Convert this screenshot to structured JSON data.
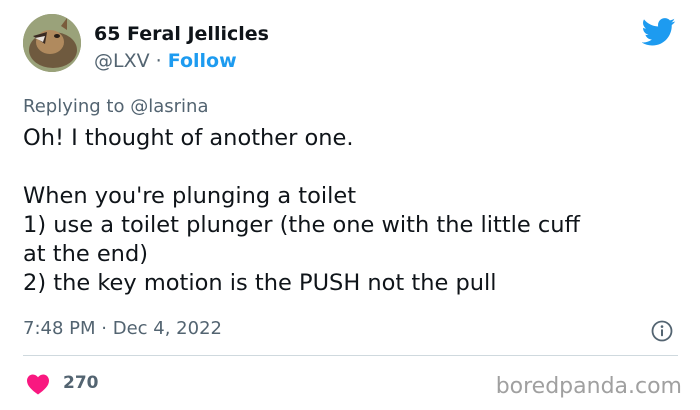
{
  "author": {
    "display_name": "65 Feral Jellicles",
    "handle": "@LXV",
    "separator": "·",
    "follow_label": "Follow"
  },
  "reply": {
    "prefix": "Replying to",
    "to": "@lasrina"
  },
  "tweet": {
    "lines": [
      "Oh! I thought of another one.",
      "",
      "When you're plunging a toilet",
      "1) use a toilet plunger (the one with the little cuff",
      "at the end)",
      "2) the key motion is the PUSH not the pull"
    ]
  },
  "meta": {
    "time": "7:48 PM",
    "separator": "·",
    "date": "Dec 4, 2022"
  },
  "engagement": {
    "likes": "270"
  },
  "watermark": "boredpanda.com",
  "colors": {
    "brand_blue": "#1d9bf0",
    "heart_red": "#f91880",
    "secondary_text": "#536471"
  },
  "icons": {
    "brand": "twitter-bird-icon",
    "info": "info-icon",
    "like": "heart-icon"
  }
}
